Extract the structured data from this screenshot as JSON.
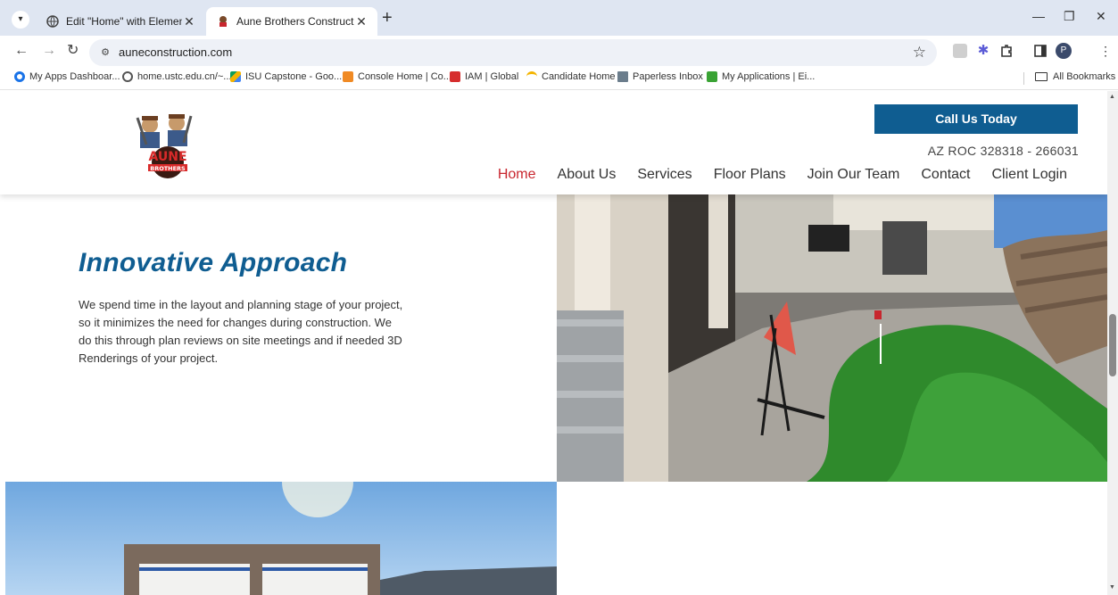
{
  "browser": {
    "tabs": [
      {
        "title": "Edit \"Home\" with Elementor",
        "active": false
      },
      {
        "title": "Aune Brothers Construction",
        "active": true
      }
    ],
    "url": "auneconstruction.com",
    "bookmarks": [
      {
        "label": "My Apps Dashboar...",
        "color": "#1a73e8"
      },
      {
        "label": "home.ustc.edu.cn/~...",
        "color": "#555555"
      },
      {
        "label": "ISU Capstone - Goo...",
        "color": "#f4b400"
      },
      {
        "label": "Console Home | Co...",
        "color": "#f08a24"
      },
      {
        "label": "IAM | Global",
        "color": "#d62d2d"
      },
      {
        "label": "Candidate Home",
        "color": "#1a73e8"
      },
      {
        "label": "Paperless Inbox",
        "color": "#6b7d8c"
      },
      {
        "label": "My Applications | Ei...",
        "color": "#3aa335"
      }
    ],
    "all_bookmarks": "All Bookmarks",
    "profile_initial": "P"
  },
  "site": {
    "call_button": "Call Us Today",
    "license": "AZ ROC 328318 - 266031",
    "nav": [
      "Home",
      "About Us",
      "Services",
      "Floor Plans",
      "Join Our Team",
      "Contact",
      "Client Login"
    ],
    "logo_top": "AUNE",
    "logo_bottom": "BROTHERS",
    "section_title": "Innovative Approach",
    "section_body": "We spend time in the layout and planning stage of your project, so it minimizes the need for changes during construction.  We do this through plan reviews on site meetings and if needed 3D Renderings of your project."
  },
  "colors": {
    "brand_blue": "#0f5d91",
    "nav_active": "#c8262e"
  }
}
